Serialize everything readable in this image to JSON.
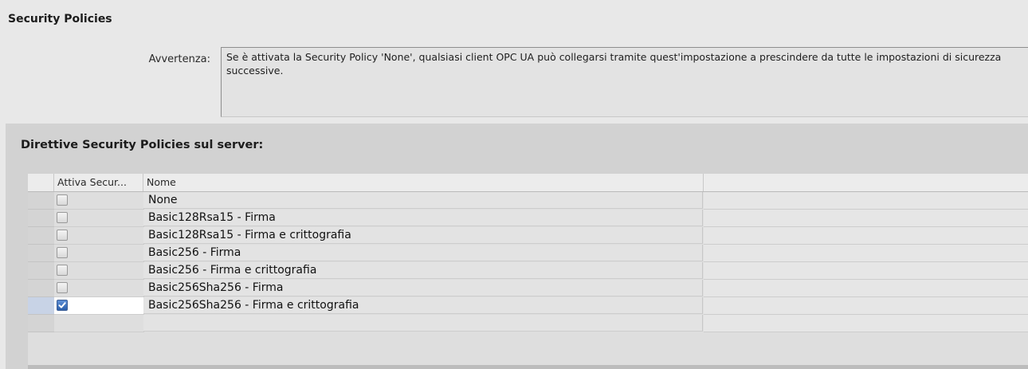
{
  "title": "Security Policies",
  "warning": {
    "label": "Avvertenza:",
    "text": "Se è attivata la Security Policy 'None', qualsiasi client OPC UA può collegarsi tramite quest'impostazione a prescindere da tutte le impostazioni di sicurezza successive."
  },
  "subtitle": "Direttive Security Policies sul server:",
  "table": {
    "columns": [
      "Attiva Secur...",
      "Nome",
      ""
    ],
    "rows": [
      {
        "active": false,
        "name": "None"
      },
      {
        "active": false,
        "name": "Basic128Rsa15 - Firma"
      },
      {
        "active": false,
        "name": "Basic128Rsa15 - Firma e crittografia"
      },
      {
        "active": false,
        "name": "Basic256 - Firma"
      },
      {
        "active": false,
        "name": "Basic256 - Firma e crittografia"
      },
      {
        "active": false,
        "name": "Basic256Sha256 - Firma"
      },
      {
        "active": true,
        "name": "Basic256Sha256 - Firma e crittografia"
      }
    ]
  },
  "icons": {
    "checkbox_unchecked": "checkbox-unchecked-icon",
    "checkbox_checked": "checkbox-checked-icon"
  },
  "colors": {
    "panel_bg": "#e8e8e8",
    "section_bg": "#d2d2d2",
    "checkbox_checked": "#2c5faa"
  }
}
